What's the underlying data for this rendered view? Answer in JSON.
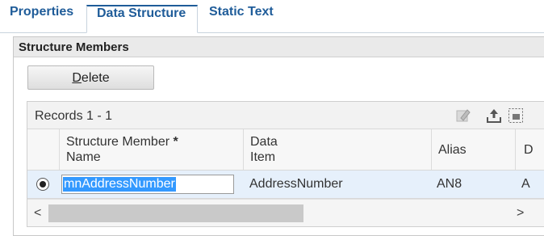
{
  "tabs": [
    {
      "label": "Properties",
      "active": false
    },
    {
      "label": "Data Structure",
      "active": true
    },
    {
      "label": "Static Text",
      "active": false
    }
  ],
  "section": {
    "title": "Structure Members"
  },
  "toolbar": {
    "delete_mnemonic": "D",
    "delete_rest": "elete"
  },
  "grid": {
    "records": "Records 1 - 1",
    "columns": {
      "name_line1": "Structure Member",
      "name_required": "*",
      "name_line2": "Name",
      "item_line1": "Data",
      "item_line2": "Item",
      "alias": "Alias",
      "next": "D"
    },
    "rows": [
      {
        "selected": true,
        "member_name": "mnAddressNumber",
        "data_item": "AddressNumber",
        "alias": "AN8",
        "next": "A"
      }
    ]
  },
  "scroll": {
    "left": "<",
    "right": ">"
  },
  "icons": [
    "edit-icon",
    "export-icon",
    "fullscreen-icon",
    "radio-selected-icon"
  ]
}
